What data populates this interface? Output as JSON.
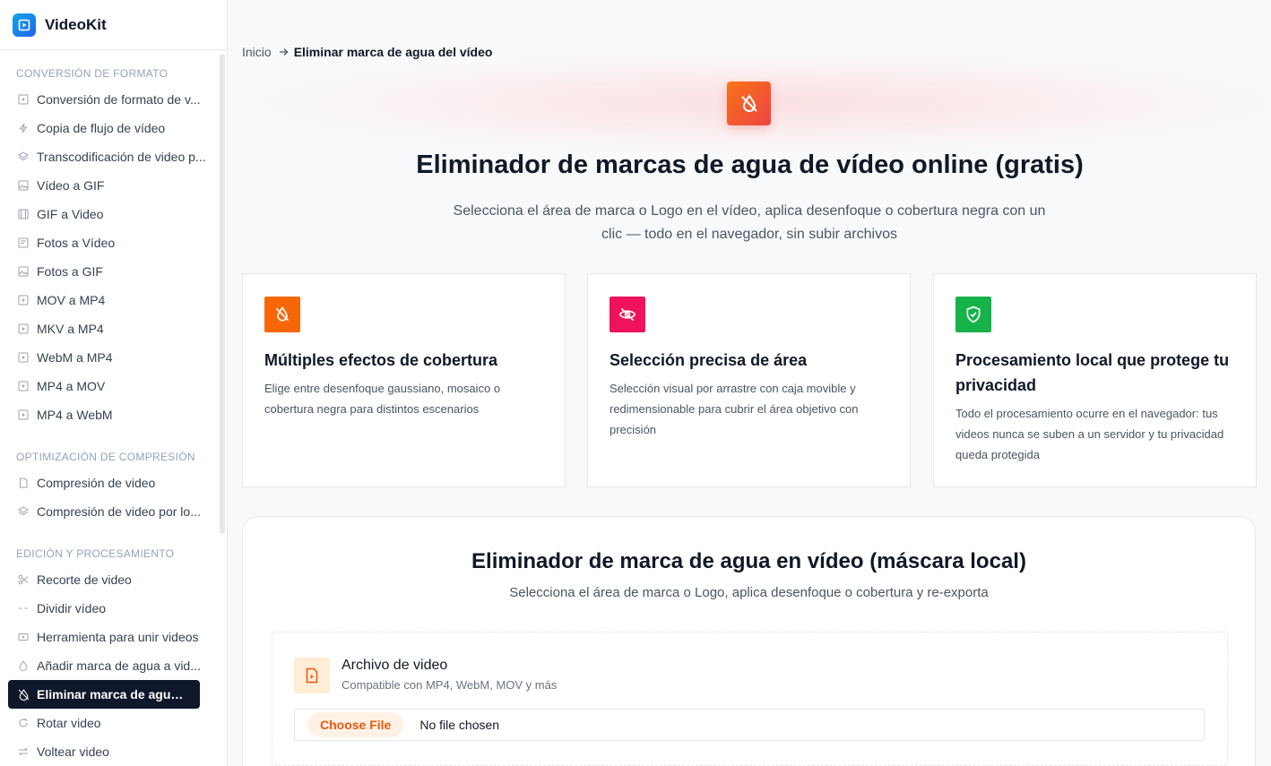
{
  "brand": {
    "name": "VideoKit"
  },
  "sidebar": {
    "groups": [
      {
        "title": "CONVERSIÓN DE FORMATO",
        "items": [
          {
            "label": "Conversión de formato de v...",
            "icon": "video-file-icon"
          },
          {
            "label": "Copia de flujo de vídeo",
            "icon": "bolt-icon"
          },
          {
            "label": "Transcodificación de video p...",
            "icon": "layers-icon"
          },
          {
            "label": "Vídeo a GIF",
            "icon": "image-icon"
          },
          {
            "label": "GIF a Video",
            "icon": "film-icon"
          },
          {
            "label": "Fotos a Vídeo",
            "icon": "gallery-icon"
          },
          {
            "label": "Fotos a GIF",
            "icon": "image-icon"
          },
          {
            "label": "MOV a MP4",
            "icon": "video-file-icon"
          },
          {
            "label": "MKV a MP4",
            "icon": "video-file-icon"
          },
          {
            "label": "WebM a MP4",
            "icon": "video-file-icon"
          },
          {
            "label": "MP4 a MOV",
            "icon": "video-file-icon"
          },
          {
            "label": "MP4 a WebM",
            "icon": "video-file-icon"
          }
        ]
      },
      {
        "title": "OPTIMIZACIÓN DE COMPRESIÓN",
        "items": [
          {
            "label": "Compresión de video",
            "icon": "file-icon"
          },
          {
            "label": "Compresión de video por lo...",
            "icon": "layers-icon"
          }
        ]
      },
      {
        "title": "EDICIÓN Y PROCESAMIENTO",
        "items": [
          {
            "label": "Recorte de video",
            "icon": "scissors-icon"
          },
          {
            "label": "Dividir vídeo",
            "icon": "split-icon"
          },
          {
            "label": "Herramienta para unir videos",
            "icon": "merge-icon"
          },
          {
            "label": "Añadir marca de agua a vid...",
            "icon": "droplet-icon"
          },
          {
            "label": "Eliminar marca de agua del...",
            "icon": "droplet-off-icon",
            "active": true
          },
          {
            "label": "Rotar video",
            "icon": "rotate-icon"
          },
          {
            "label": "Voltear video",
            "icon": "flip-icon"
          }
        ]
      }
    ]
  },
  "breadcrumb": {
    "home": "Inicio",
    "current": "Eliminar marca de agua del vídeo"
  },
  "hero": {
    "title": "Eliminador de marcas de agua de vídeo online (gratis)",
    "subtitle": "Selecciona el área de marca o Logo en el vídeo, aplica desenfoque o cobertura negra con un clic — todo en el navegador, sin subir archivos",
    "icon": "droplet-off-icon",
    "icon_gradient": [
      "#f97316",
      "#ef4444"
    ]
  },
  "features": [
    {
      "title": "Múltiples efectos de cobertura",
      "desc": "Elige entre desenfoque gaussiano, mosaico o cobertura negra para distintos escenarios",
      "icon": "droplet-off-icon",
      "color": "#f76707"
    },
    {
      "title": "Selección precisa de área",
      "desc": "Selección visual por arrastre con caja movible y redimensionable para cubrir el área objetivo con precisión",
      "icon": "eye-off-icon",
      "color": "#f0125a"
    },
    {
      "title": "Procesamiento local que protege tu privacidad",
      "desc": "Todo el procesamiento ocurre en el navegador: tus videos nunca se suben a un servidor y tu privacidad queda protegida",
      "icon": "shield-check-icon",
      "color": "#16b34a"
    }
  ],
  "tool": {
    "title": "Eliminador de marca de agua en vídeo (máscara local)",
    "subtitle": "Selecciona el área de marca o Logo, aplica desenfoque o cobertura y re-exporta",
    "file_label": "Archivo de video",
    "file_hint": "Compatible con MP4, WebM, MOV y más",
    "choose_button": "Choose File",
    "no_file_text": "No file chosen",
    "accent": "#ea580c"
  }
}
